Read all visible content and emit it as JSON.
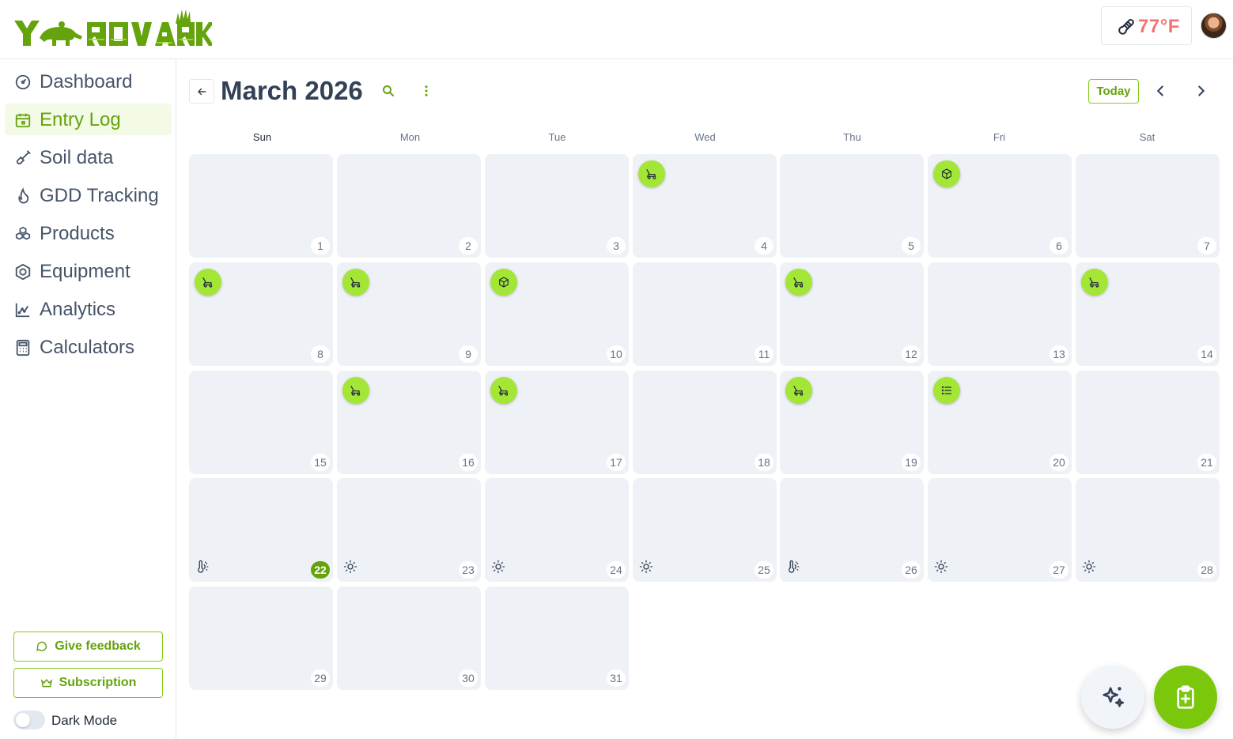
{
  "app": {
    "brand": "YARDVARK",
    "accent": "#65a30d",
    "accent_light": "#a3e635"
  },
  "header": {
    "temperature": "77°F",
    "temperature_color": "#f87171",
    "thermometer_icon": "thermometer-icon",
    "avatar": "user-avatar"
  },
  "sidebar": {
    "items": [
      {
        "label": "Dashboard",
        "icon": "dashboard-gauge-icon",
        "active": false
      },
      {
        "label": "Entry Log",
        "icon": "calendar-icon",
        "active": true
      },
      {
        "label": "Soil data",
        "icon": "shovel-icon",
        "active": false
      },
      {
        "label": "GDD Tracking",
        "icon": "flame-icon",
        "active": false
      },
      {
        "label": "Products",
        "icon": "boxes-icon",
        "active": false
      },
      {
        "label": "Equipment",
        "icon": "hex-nut-icon",
        "active": false
      },
      {
        "label": "Analytics",
        "icon": "chart-icon",
        "active": false
      },
      {
        "label": "Calculators",
        "icon": "calculator-icon",
        "active": false
      }
    ],
    "feedback_label": "Give feedback",
    "subscription_label": "Subscription",
    "dark_mode_label": "Dark Mode",
    "dark_mode_on": false
  },
  "calendar": {
    "title": "March 2026",
    "today_label": "Today",
    "weekdays": [
      "Sun",
      "Mon",
      "Tue",
      "Wed",
      "Thu",
      "Fri",
      "Sat"
    ],
    "today": 22,
    "days": [
      {
        "n": "1"
      },
      {
        "n": "2"
      },
      {
        "n": "3"
      },
      {
        "n": "4",
        "entry": "mower"
      },
      {
        "n": "5"
      },
      {
        "n": "6",
        "entry": "product"
      },
      {
        "n": "7"
      },
      {
        "n": "8",
        "entry": "mower"
      },
      {
        "n": "9",
        "entry": "mower"
      },
      {
        "n": "10",
        "entry": "product"
      },
      {
        "n": "11"
      },
      {
        "n": "12",
        "entry": "mower"
      },
      {
        "n": "13"
      },
      {
        "n": "14",
        "entry": "mower"
      },
      {
        "n": "15"
      },
      {
        "n": "16",
        "entry": "mower"
      },
      {
        "n": "17",
        "entry": "mower"
      },
      {
        "n": "18"
      },
      {
        "n": "19",
        "entry": "mower"
      },
      {
        "n": "20",
        "entry": "list"
      },
      {
        "n": "21"
      },
      {
        "n": "22",
        "weather": "hot"
      },
      {
        "n": "23",
        "weather": "sunny"
      },
      {
        "n": "24",
        "weather": "sunny"
      },
      {
        "n": "25",
        "weather": "sunny"
      },
      {
        "n": "26",
        "weather": "hot"
      },
      {
        "n": "27",
        "weather": "sunny"
      },
      {
        "n": "28",
        "weather": "sunny"
      },
      {
        "n": "29"
      },
      {
        "n": "30"
      },
      {
        "n": "31"
      }
    ]
  },
  "fabs": {
    "ai_icon": "sparkles-icon",
    "add_icon": "clipboard-plus-icon"
  }
}
